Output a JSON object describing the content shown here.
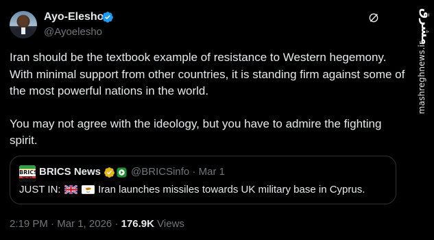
{
  "author": {
    "name": "Ayo-Elesho",
    "handle": "@Ayoelesho",
    "verified": true,
    "verified_color": "#1d9bf0"
  },
  "tweet": {
    "paragraphs": [
      "Iran should be the textbook example of resistance to Western hegemony. With minimal support from other countries, it is standing firm against some of the most powerful nations in the world.",
      "You may not agree with the ideology, but you have to admire the fighting spirit."
    ]
  },
  "quoted": {
    "logo_text": "BRICS",
    "logo_subtext": "NEWS",
    "name": "BRICS News",
    "badge": "gold-verified",
    "handle": "@BRICSinfo",
    "separator": "·",
    "date": "Mar 1",
    "text_prefix": "JUST IN:",
    "text_body": "Iran launches missiles towards UK military base in Cyprus."
  },
  "footer": {
    "time": "2:19 PM",
    "separator": "·",
    "date": "Mar 1, 2026",
    "separator2": "·",
    "views_count": "176.9K",
    "views_label": "Views"
  },
  "watermark": {
    "logo": "مشرق",
    "url": "mashreghnews.ir"
  },
  "colors": {
    "background": "#000000",
    "text": "#e7e9ea",
    "muted": "#71767b",
    "border": "#2f3336"
  },
  "icons": [
    "verified-badge-icon",
    "grok-icon",
    "gold-verified-badge-icon",
    "affiliate-badge-icon",
    "uk-flag-icon",
    "cyprus-flag-icon"
  ]
}
